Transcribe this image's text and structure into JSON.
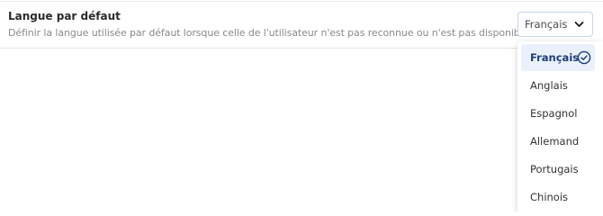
{
  "setting": {
    "title": "Langue par défaut",
    "description": "Définir la langue utilisée par défaut lorsque celle de l'utilisateur n'est pas reconnue ou n'est pas disponible."
  },
  "select": {
    "value": "Français",
    "caret_icon": "chevron-down-icon"
  },
  "dropdown": {
    "options": [
      {
        "label": "Français",
        "selected": true
      },
      {
        "label": "Anglais",
        "selected": false
      },
      {
        "label": "Espagnol",
        "selected": false
      },
      {
        "label": "Allemand",
        "selected": false
      },
      {
        "label": "Portugais",
        "selected": false
      },
      {
        "label": "Chinois",
        "selected": false
      }
    ],
    "selected_icon": "check-circle-icon"
  },
  "colors": {
    "accent": "#1c3f7a",
    "selected_bg": "#eaf1fb",
    "description_text": "#8a8a8a"
  }
}
